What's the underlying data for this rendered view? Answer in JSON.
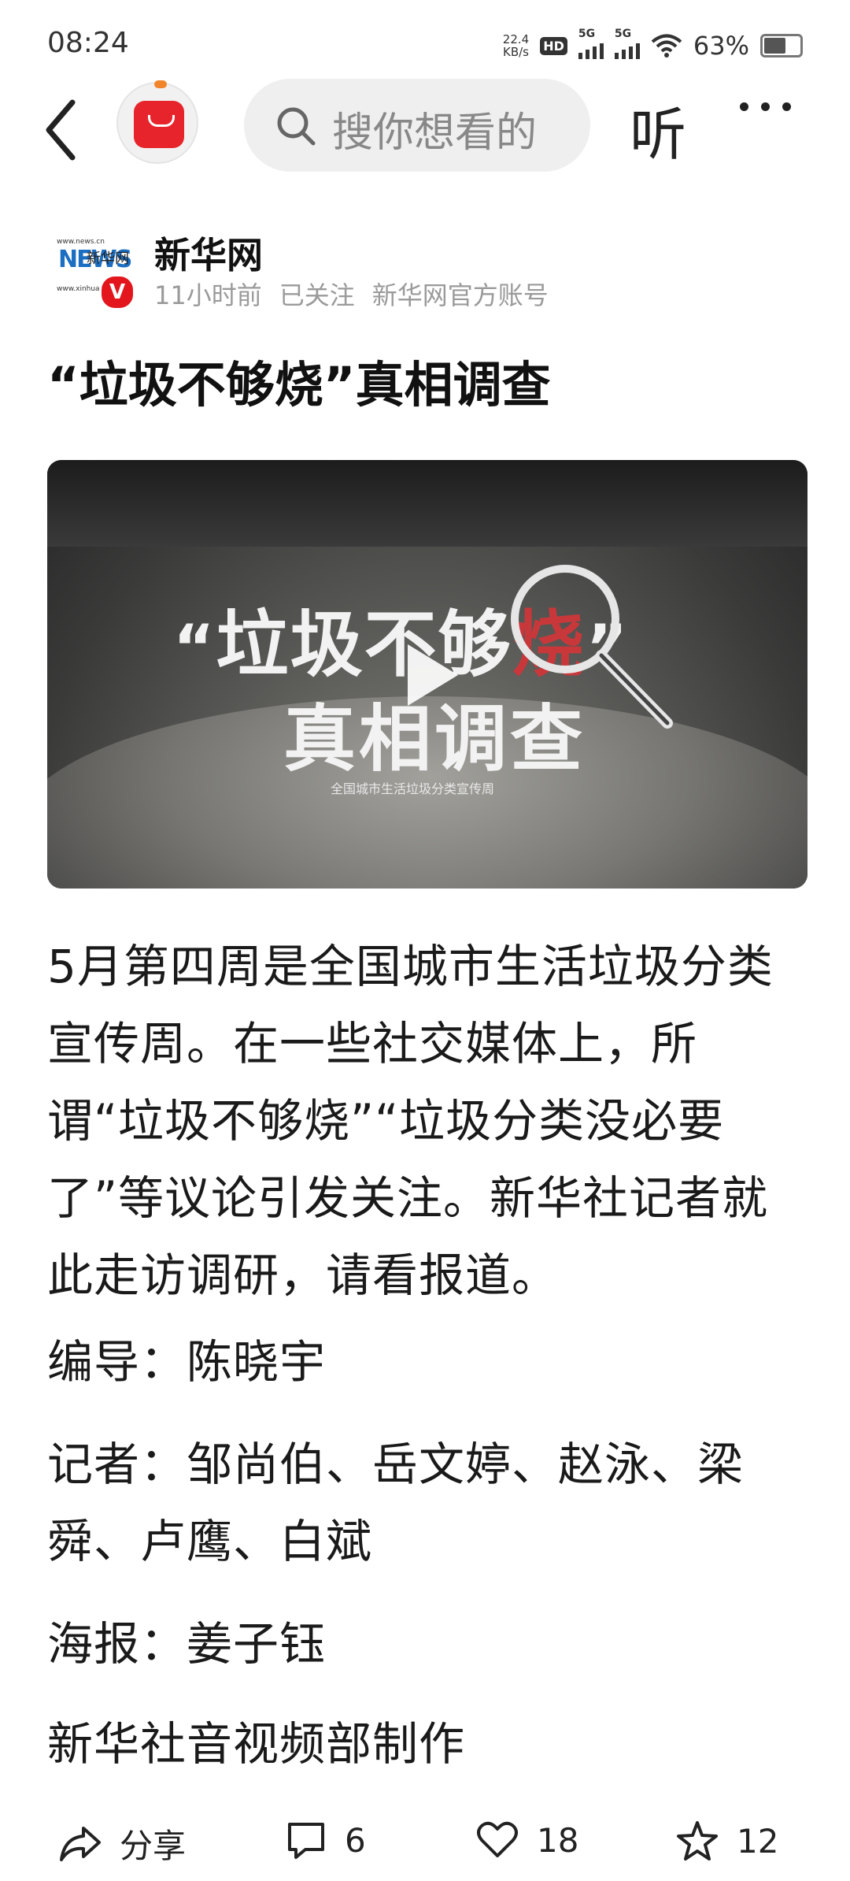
{
  "status_bar": {
    "time": "08:24",
    "net_speed_value": "22.4",
    "net_speed_unit": "KB/s",
    "hd_label": "HD",
    "sim1_label": "5G",
    "sim2_label": "5G",
    "battery_percent": "63%",
    "battery_level": 0.63
  },
  "nav": {
    "search_placeholder": "搜你想看的",
    "listen_label": "听",
    "back_icon": "chevron-left-icon",
    "more_icon": "more-dots-icon"
  },
  "author": {
    "name": "新华网",
    "logo_text_url": "www.news.cn",
    "logo_text_big": "NEWS",
    "logo_text_cn": "新华网",
    "logo_text_sub": "www.xinhuanet.com",
    "verified_label": "V",
    "time_ago": "11小时前",
    "follow_status": "已关注",
    "account_type": "新华网官方账号"
  },
  "article": {
    "title": "“垃圾不够烧”真相调查",
    "video": {
      "line1_open_quote": "“",
      "line1_text": "垃圾不够",
      "line1_highlight": "烧",
      "line1_close_quote": "”",
      "line2_text": "真相调查",
      "subtitle": "全国城市生活垃圾分类宣传周"
    },
    "paragraph": "5月第四周是全国城市生活垃圾分类宣传周。在一些社交媒体上，所谓“垃圾不够烧”“垃圾分类没必要了”等议论引发关注。新华社记者就此走访调研，请看报道。",
    "director": "编导：陈晓宇",
    "reporters": "记者：邹尚伯、岳文婷、赵泳、梁舜、卢鹰、白斌",
    "poster": "海报：姜子钰",
    "producer": "新华社音视频部制作"
  },
  "actions": {
    "share_label": "分享",
    "comment_count": "6",
    "like_count": "18",
    "favorite_count": "12"
  }
}
